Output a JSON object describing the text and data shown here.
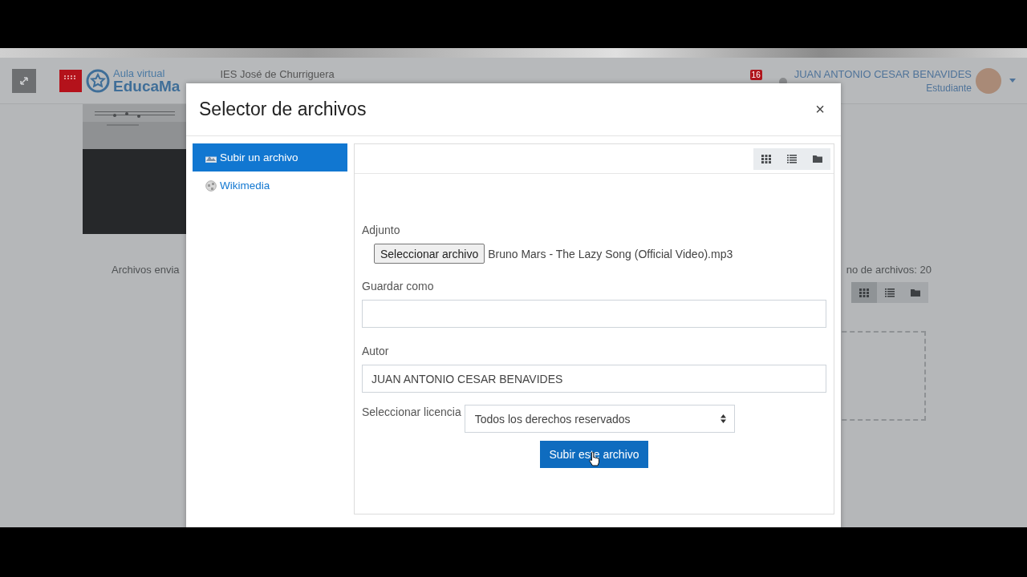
{
  "page": {
    "header": {
      "logo": {
        "subtitle": "Aula virtual",
        "name": "EducaMa"
      },
      "site": "IES José de Churriguera",
      "notifications": {
        "count": "16"
      },
      "user": {
        "name": "JUAN ANTONIO CESAR BENAVIDES",
        "role": "Estudiante"
      }
    },
    "background": {
      "files_label": "Archivos envia",
      "max_files": "no de archivos: 20",
      "views": [
        {
          "kind": "icons",
          "selected": true
        },
        {
          "kind": "list",
          "selected": false
        },
        {
          "kind": "tree",
          "selected": false
        }
      ]
    }
  },
  "dialog": {
    "title": "Selector de archivos",
    "close": "×",
    "sources": [
      {
        "label": "Subir un archivo",
        "kind": "upload",
        "selected": true
      },
      {
        "label": "Wikimedia",
        "kind": "wiki",
        "selected": false
      }
    ],
    "views": [
      {
        "kind": "icons"
      },
      {
        "kind": "list"
      },
      {
        "kind": "tree"
      }
    ],
    "form": {
      "attachment": {
        "label": "Adjunto",
        "button": "Seleccionar archivo",
        "file": "Bruno Mars - The Lazy Song (Official Video).mp3"
      },
      "save_as": {
        "label": "Guardar como"
      },
      "author": {
        "label": "Autor",
        "value": "JUAN ANTONIO CESAR BENAVIDES"
      },
      "license": {
        "label": "Seleccionar licencia",
        "value": "Todos los derechos reservados"
      },
      "submit": "Subir este archivo"
    }
  }
}
